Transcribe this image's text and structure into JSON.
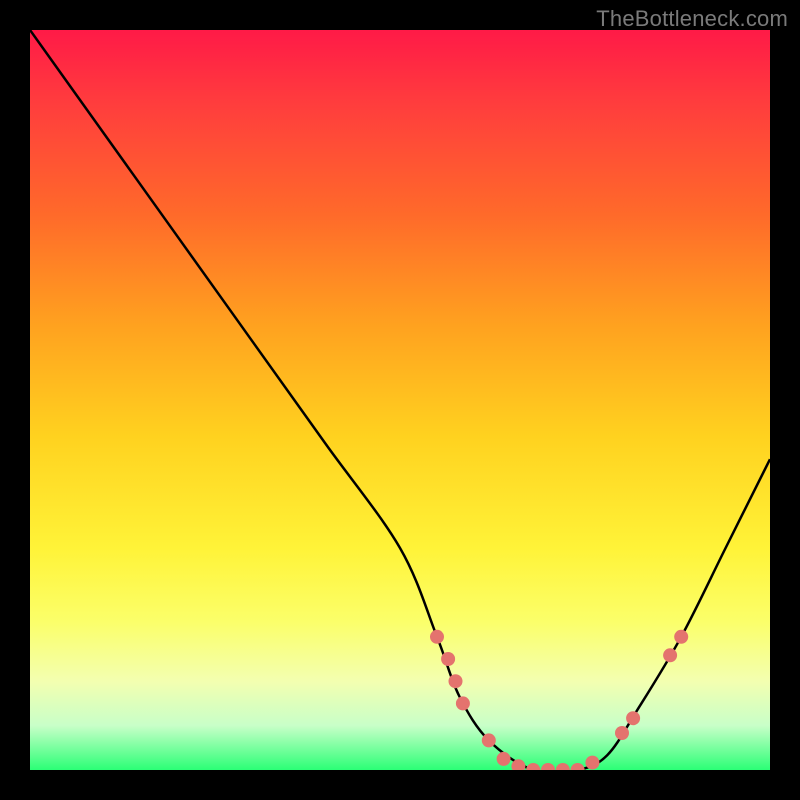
{
  "attribution": "TheBottleneck.com",
  "chart_data": {
    "type": "line",
    "title": "",
    "xlabel": "",
    "ylabel": "",
    "xlim": [
      0,
      100
    ],
    "ylim": [
      0,
      100
    ],
    "series": [
      {
        "name": "bottleneck-curve",
        "x": [
          0,
          10,
          20,
          30,
          40,
          50,
          55,
          58,
          62,
          68,
          74,
          78,
          82,
          88,
          94,
          100
        ],
        "y": [
          100,
          86,
          72,
          58,
          44,
          30,
          18,
          10,
          4,
          0,
          0,
          2,
          8,
          18,
          30,
          42
        ]
      }
    ],
    "markers": {
      "name": "highlight-points",
      "color": "#e4736e",
      "points": [
        {
          "x": 55,
          "y": 18
        },
        {
          "x": 56.5,
          "y": 15
        },
        {
          "x": 57.5,
          "y": 12
        },
        {
          "x": 58.5,
          "y": 9
        },
        {
          "x": 62,
          "y": 4
        },
        {
          "x": 64,
          "y": 1.5
        },
        {
          "x": 66,
          "y": 0.5
        },
        {
          "x": 68,
          "y": 0
        },
        {
          "x": 70,
          "y": 0
        },
        {
          "x": 72,
          "y": 0
        },
        {
          "x": 74,
          "y": 0
        },
        {
          "x": 76,
          "y": 1
        },
        {
          "x": 80,
          "y": 5
        },
        {
          "x": 81.5,
          "y": 7
        },
        {
          "x": 86.5,
          "y": 15.5
        },
        {
          "x": 88,
          "y": 18
        }
      ]
    },
    "background_gradient": {
      "top": "#ff1a47",
      "mid": "#ffd21f",
      "bottom": "#2bff76"
    }
  }
}
